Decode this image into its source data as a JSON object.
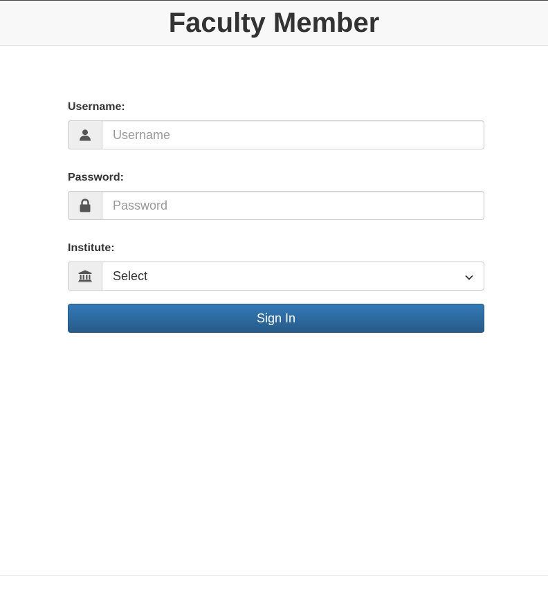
{
  "header": {
    "title": "Faculty Member"
  },
  "form": {
    "username": {
      "label": "Username:",
      "placeholder": "Username",
      "value": "",
      "icon": "user-icon"
    },
    "password": {
      "label": "Password:",
      "placeholder": "Password",
      "value": "",
      "icon": "lock-icon"
    },
    "institute": {
      "label": "Institute:",
      "selected": "Select",
      "icon": "institution-icon"
    },
    "submit_label": "Sign In"
  },
  "colors": {
    "header_bg": "#f8f8f8",
    "button_primary": "#337ab7",
    "button_primary_dark": "#265a88",
    "text": "#333333"
  }
}
